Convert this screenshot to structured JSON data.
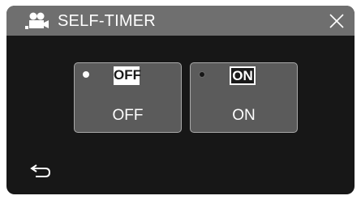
{
  "header": {
    "mode_icon": "video-camera-icon",
    "title": "SELF-TIMER",
    "close_icon": "close-icon"
  },
  "options": [
    {
      "badge": "OFF",
      "label": "OFF",
      "selected": true
    },
    {
      "badge": "ON",
      "label": "ON",
      "selected": false
    }
  ],
  "footer": {
    "back_icon": "return-arrow-icon"
  },
  "colors": {
    "header_bg": "#6f6f6f",
    "screen_bg": "#171717",
    "option_bg": "#5b5b5b",
    "option_border": "#a9a9a9",
    "text": "#ffffff"
  }
}
